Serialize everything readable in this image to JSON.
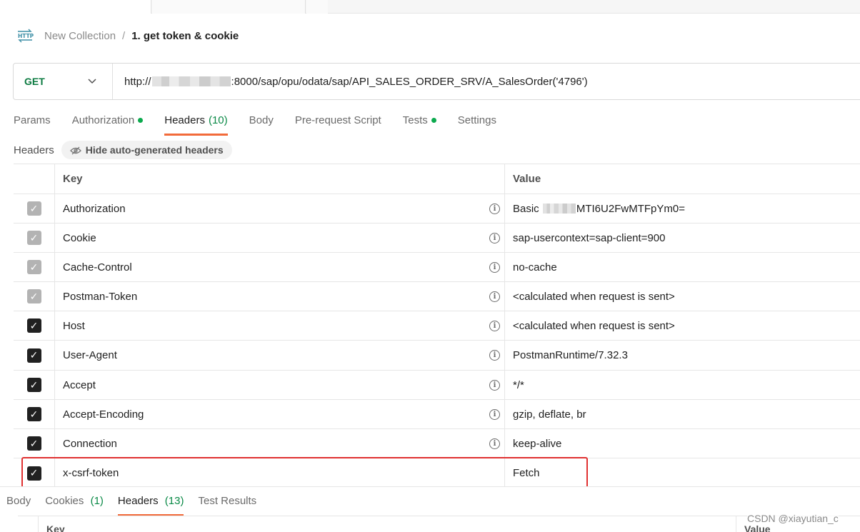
{
  "breadcrumb": {
    "icon": "http-icon",
    "parent": "New Collection",
    "separator": "/",
    "current": "1. get token & cookie"
  },
  "request": {
    "method": "GET",
    "url_prefix": "http://",
    "url_suffix": ":8000/sap/opu/odata/sap/API_SALES_ORDER_SRV/A_SalesOrder('4796')"
  },
  "request_tabs": [
    {
      "label": "Params",
      "count": "",
      "dot": false
    },
    {
      "label": "Authorization",
      "count": "",
      "dot": true
    },
    {
      "label": "Headers",
      "count": "(10)",
      "dot": false,
      "active": true
    },
    {
      "label": "Body",
      "count": "",
      "dot": false
    },
    {
      "label": "Pre-request Script",
      "count": "",
      "dot": false
    },
    {
      "label": "Tests",
      "count": "",
      "dot": true
    },
    {
      "label": "Settings",
      "count": "",
      "dot": false
    }
  ],
  "headers_section": {
    "title": "Headers",
    "hide_button": "Hide auto-generated headers"
  },
  "table": {
    "columns": {
      "key": "Key",
      "value": "Value"
    },
    "rows": [
      {
        "key": "Authorization",
        "value_prefix": "Basic ",
        "value": "MTI6U2FwMTFpYm0=",
        "checkbox": "auto",
        "info": true,
        "blurred": true
      },
      {
        "key": "Cookie",
        "value_prefix": "",
        "value": "sap-usercontext=sap-client=900",
        "checkbox": "auto",
        "info": true
      },
      {
        "key": "Cache-Control",
        "value_prefix": "",
        "value": "no-cache",
        "checkbox": "auto",
        "info": true
      },
      {
        "key": "Postman-Token",
        "value_prefix": "",
        "value": "<calculated when request is sent>",
        "checkbox": "auto",
        "info": true
      },
      {
        "key": "Host",
        "value_prefix": "",
        "value": "<calculated when request is sent>",
        "checkbox": "checked",
        "info": true
      },
      {
        "key": "User-Agent",
        "value_prefix": "",
        "value": "PostmanRuntime/7.32.3",
        "checkbox": "checked",
        "info": true
      },
      {
        "key": "Accept",
        "value_prefix": "",
        "value": "*/*",
        "checkbox": "checked",
        "info": true
      },
      {
        "key": "Accept-Encoding",
        "value_prefix": "",
        "value": "gzip, deflate, br",
        "checkbox": "checked",
        "info": true
      },
      {
        "key": "Connection",
        "value_prefix": "",
        "value": "keep-alive",
        "checkbox": "checked",
        "info": true
      },
      {
        "key": "x-csrf-token",
        "value_prefix": "",
        "value": "Fetch",
        "checkbox": "checked",
        "info": false
      }
    ]
  },
  "response_tabs": [
    {
      "label": "Body",
      "count": ""
    },
    {
      "label": "Cookies",
      "count": "(1)"
    },
    {
      "label": "Headers",
      "count": "(13)",
      "active": true
    },
    {
      "label": "Test Results",
      "count": ""
    }
  ],
  "response_table": {
    "key": "Key",
    "value": "Value"
  },
  "watermark": "CSDN @xiayutian_c",
  "colors": {
    "accent": "#f26b3a",
    "method_get": "#0b7a40",
    "highlight": "#e03131",
    "status_dot": "#0caa4e"
  }
}
